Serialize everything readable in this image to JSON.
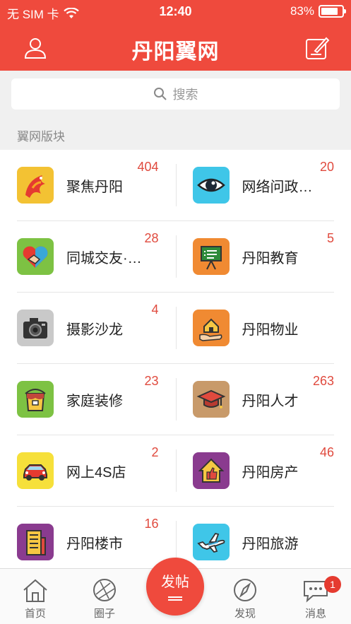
{
  "status_bar": {
    "carrier": "无 SIM 卡",
    "time": "12:40",
    "battery_percent": "83%",
    "battery_level": 0.83
  },
  "header": {
    "title": "丹阳翼网",
    "user_icon": "user-icon",
    "edit_icon": "edit-icon",
    "color": "#ef4a3d"
  },
  "search": {
    "placeholder": "搜索"
  },
  "section": {
    "label": "翼网版块"
  },
  "forums": [
    {
      "name": "聚焦丹阳",
      "count": "404",
      "icon": "phoenix-icon"
    },
    {
      "name": "网络问政…",
      "count": "20",
      "icon": "eye-icon"
    },
    {
      "name": "同城交友·…",
      "count": "28",
      "icon": "handshake-icon"
    },
    {
      "name": "丹阳教育",
      "count": "5",
      "icon": "blackboard-icon"
    },
    {
      "name": "摄影沙龙",
      "count": "4",
      "icon": "camera-icon"
    },
    {
      "name": "丹阳物业",
      "count": "",
      "icon": "house-hand-icon"
    },
    {
      "name": "家庭装修",
      "count": "23",
      "icon": "paint-bucket-icon"
    },
    {
      "name": "丹阳人才",
      "count": "263",
      "icon": "graduation-cap-icon"
    },
    {
      "name": "网上4S店",
      "count": "2",
      "icon": "car-icon"
    },
    {
      "name": "丹阳房产",
      "count": "46",
      "icon": "house-thumb-icon"
    },
    {
      "name": "丹阳楼市",
      "count": "16",
      "icon": "building-icon"
    },
    {
      "name": "丹阳旅游",
      "count": "",
      "icon": "airplane-icon"
    }
  ],
  "tabbar": {
    "home": "首页",
    "circle": "圈子",
    "post": "发帖",
    "discover": "发现",
    "messages": "消息",
    "message_badge": "1"
  }
}
